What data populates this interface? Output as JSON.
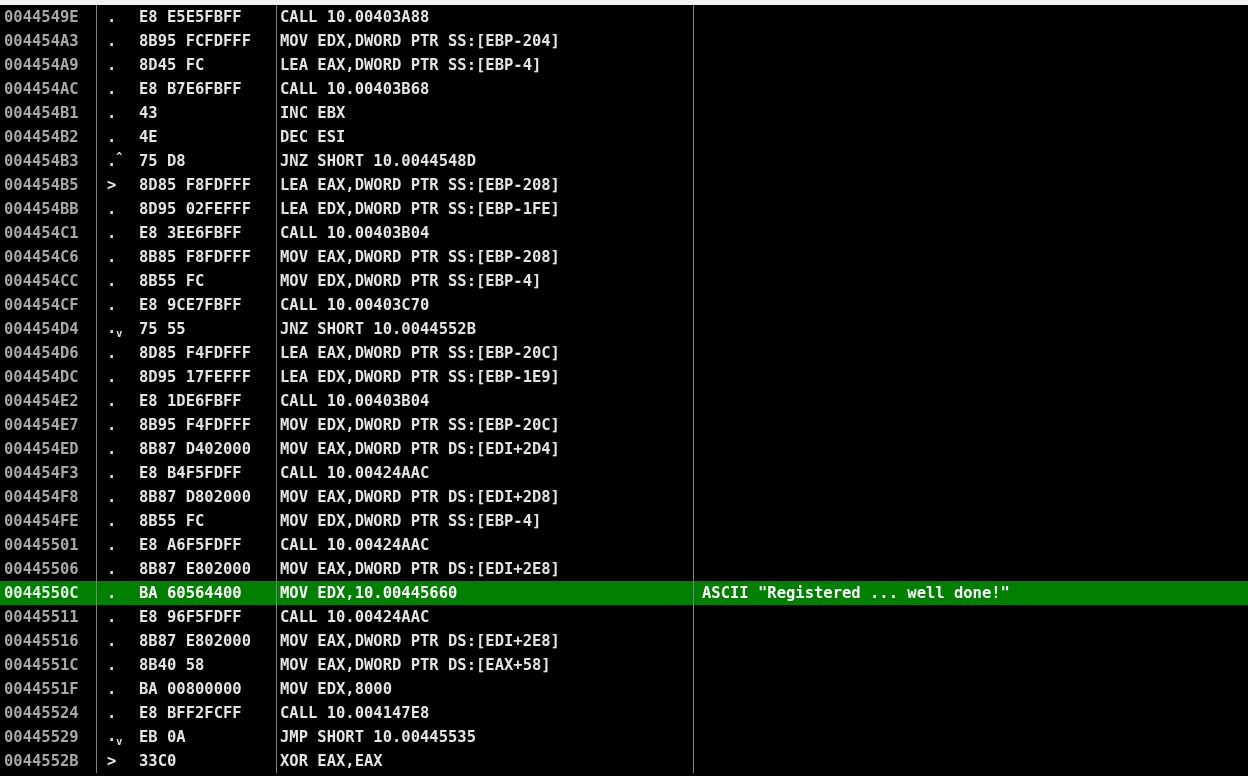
{
  "rows": [
    {
      "address": "0044549E",
      "marker": ".",
      "hex": "E8 E5E5FBFF",
      "disasm": "CALL 10.00403A88",
      "comment": "",
      "selected": false
    },
    {
      "address": "004454A3",
      "marker": ".",
      "hex": "8B95 FCFDFFF",
      "disasm": "MOV EDX,DWORD PTR SS:[EBP-204]",
      "comment": "",
      "selected": false
    },
    {
      "address": "004454A9",
      "marker": ".",
      "hex": "8D45 FC",
      "disasm": "LEA EAX,DWORD PTR SS:[EBP-4]",
      "comment": "",
      "selected": false
    },
    {
      "address": "004454AC",
      "marker": ".",
      "hex": "E8 B7E6FBFF",
      "disasm": "CALL 10.00403B68",
      "comment": "",
      "selected": false
    },
    {
      "address": "004454B1",
      "marker": ".",
      "hex": "43",
      "disasm": "INC EBX",
      "comment": "",
      "selected": false
    },
    {
      "address": "004454B2",
      "marker": ".",
      "hex": "4E",
      "disasm": "DEC ESI",
      "comment": "",
      "selected": false
    },
    {
      "address": "004454B3",
      "marker": ".$^{^}$",
      "hex": "75 D8",
      "disasm": "JNZ SHORT 10.0044548D",
      "comment": "",
      "selected": false
    },
    {
      "address": "004454B5",
      "marker": ">",
      "hex": "8D85 F8FDFFF",
      "disasm": "LEA EAX,DWORD PTR SS:[EBP-208]",
      "comment": "",
      "selected": false
    },
    {
      "address": "004454BB",
      "marker": ".",
      "hex": "8D95 02FEFFF",
      "disasm": "LEA EDX,DWORD PTR SS:[EBP-1FE]",
      "comment": "",
      "selected": false
    },
    {
      "address": "004454C1",
      "marker": ".",
      "hex": "E8 3EE6FBFF",
      "disasm": "CALL 10.00403B04",
      "comment": "",
      "selected": false
    },
    {
      "address": "004454C6",
      "marker": ".",
      "hex": "8B85 F8FDFFF",
      "disasm": "MOV EAX,DWORD PTR SS:[EBP-208]",
      "comment": "",
      "selected": false
    },
    {
      "address": "004454CC",
      "marker": ".",
      "hex": "8B55 FC",
      "disasm": "MOV EDX,DWORD PTR SS:[EBP-4]",
      "comment": "",
      "selected": false
    },
    {
      "address": "004454CF",
      "marker": ".",
      "hex": "E8 9CE7FBFF",
      "disasm": "CALL 10.00403C70",
      "comment": "",
      "selected": false
    },
    {
      "address": "004454D4",
      "marker": ".$_{v}$",
      "hex": "75 55",
      "disasm": "JNZ SHORT 10.0044552B",
      "comment": "",
      "selected": false
    },
    {
      "address": "004454D6",
      "marker": ".",
      "hex": "8D85 F4FDFFF",
      "disasm": "LEA EAX,DWORD PTR SS:[EBP-20C]",
      "comment": "",
      "selected": false
    },
    {
      "address": "004454DC",
      "marker": ".",
      "hex": "8D95 17FEFFF",
      "disasm": "LEA EDX,DWORD PTR SS:[EBP-1E9]",
      "comment": "",
      "selected": false
    },
    {
      "address": "004454E2",
      "marker": ".",
      "hex": "E8 1DE6FBFF",
      "disasm": "CALL 10.00403B04",
      "comment": "",
      "selected": false
    },
    {
      "address": "004454E7",
      "marker": ".",
      "hex": "8B95 F4FDFFF",
      "disasm": "MOV EDX,DWORD PTR SS:[EBP-20C]",
      "comment": "",
      "selected": false
    },
    {
      "address": "004454ED",
      "marker": ".",
      "hex": "8B87 D402000",
      "disasm": "MOV EAX,DWORD PTR DS:[EDI+2D4]",
      "comment": "",
      "selected": false
    },
    {
      "address": "004454F3",
      "marker": ".",
      "hex": "E8 B4F5FDFF",
      "disasm": "CALL 10.00424AAC",
      "comment": "",
      "selected": false
    },
    {
      "address": "004454F8",
      "marker": ".",
      "hex": "8B87 D802000",
      "disasm": "MOV EAX,DWORD PTR DS:[EDI+2D8]",
      "comment": "",
      "selected": false
    },
    {
      "address": "004454FE",
      "marker": ".",
      "hex": "8B55 FC",
      "disasm": "MOV EDX,DWORD PTR SS:[EBP-4]",
      "comment": "",
      "selected": false
    },
    {
      "address": "00445501",
      "marker": ".",
      "hex": "E8 A6F5FDFF",
      "disasm": "CALL 10.00424AAC",
      "comment": "",
      "selected": false
    },
    {
      "address": "00445506",
      "marker": ".",
      "hex": "8B87 E802000",
      "disasm": "MOV EAX,DWORD PTR DS:[EDI+2E8]",
      "comment": "",
      "selected": false
    },
    {
      "address": "0044550C",
      "marker": ".",
      "hex": "BA 60564400",
      "disasm": "MOV EDX,10.00445660",
      "comment": "ASCII \"Registered ... well done!\"",
      "selected": true
    },
    {
      "address": "00445511",
      "marker": ".",
      "hex": "E8 96F5FDFF",
      "disasm": "CALL 10.00424AAC",
      "comment": "",
      "selected": false
    },
    {
      "address": "00445516",
      "marker": ".",
      "hex": "8B87 E802000",
      "disasm": "MOV EAX,DWORD PTR DS:[EDI+2E8]",
      "comment": "",
      "selected": false
    },
    {
      "address": "0044551C",
      "marker": ".",
      "hex": "8B40 58",
      "disasm": "MOV EAX,DWORD PTR DS:[EAX+58]",
      "comment": "",
      "selected": false
    },
    {
      "address": "0044551F",
      "marker": ".",
      "hex": "BA 00800000",
      "disasm": "MOV EDX,8000",
      "comment": "",
      "selected": false
    },
    {
      "address": "00445524",
      "marker": ".",
      "hex": "E8 BFF2FCFF",
      "disasm": "CALL 10.004147E8",
      "comment": "",
      "selected": false
    },
    {
      "address": "00445529",
      "marker": ".$_{v}$",
      "hex": "EB 0A",
      "disasm": "JMP SHORT 10.00445535",
      "comment": "",
      "selected": false
    },
    {
      "address": "0044552B",
      "marker": ">",
      "hex": "33C0",
      "disasm": "XOR EAX,EAX",
      "comment": "",
      "selected": false
    }
  ]
}
